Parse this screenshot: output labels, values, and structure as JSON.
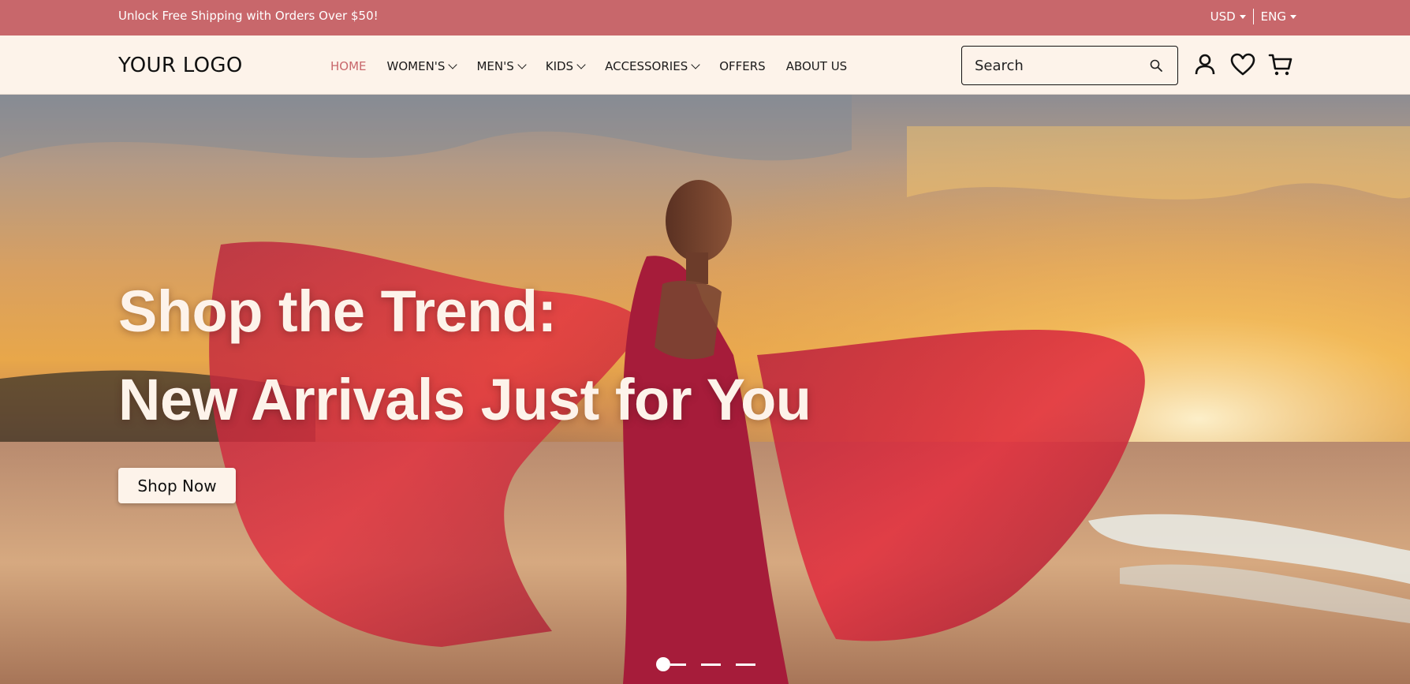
{
  "topbar": {
    "promo": "Unlock Free Shipping with Orders Over $50!",
    "currency": "USD",
    "language": "ENG"
  },
  "header": {
    "logo": "YOUR LOGO",
    "nav": [
      {
        "label": "HOME",
        "active": true,
        "dropdown": false
      },
      {
        "label": "WOMEN'S",
        "active": false,
        "dropdown": true
      },
      {
        "label": "MEN'S",
        "active": false,
        "dropdown": true
      },
      {
        "label": "KIDS",
        "active": false,
        "dropdown": true
      },
      {
        "label": "ACCESSORIES",
        "active": false,
        "dropdown": true
      },
      {
        "label": "OFFERS",
        "active": false,
        "dropdown": false
      },
      {
        "label": "ABOUT US",
        "active": false,
        "dropdown": false
      }
    ],
    "search": {
      "placeholder": "Search",
      "value": ""
    },
    "icons": [
      "search-icon",
      "user-icon",
      "heart-icon",
      "cart-icon"
    ]
  },
  "hero": {
    "headline_line1": "Shop the Trend:",
    "headline_line2": "New Arrivals Just for You",
    "cta": "Shop Now",
    "slides": 3,
    "active_slide": 1
  },
  "colors": {
    "accent": "#c8676b",
    "header_bg": "#fdf3ea",
    "text": "#111111"
  }
}
